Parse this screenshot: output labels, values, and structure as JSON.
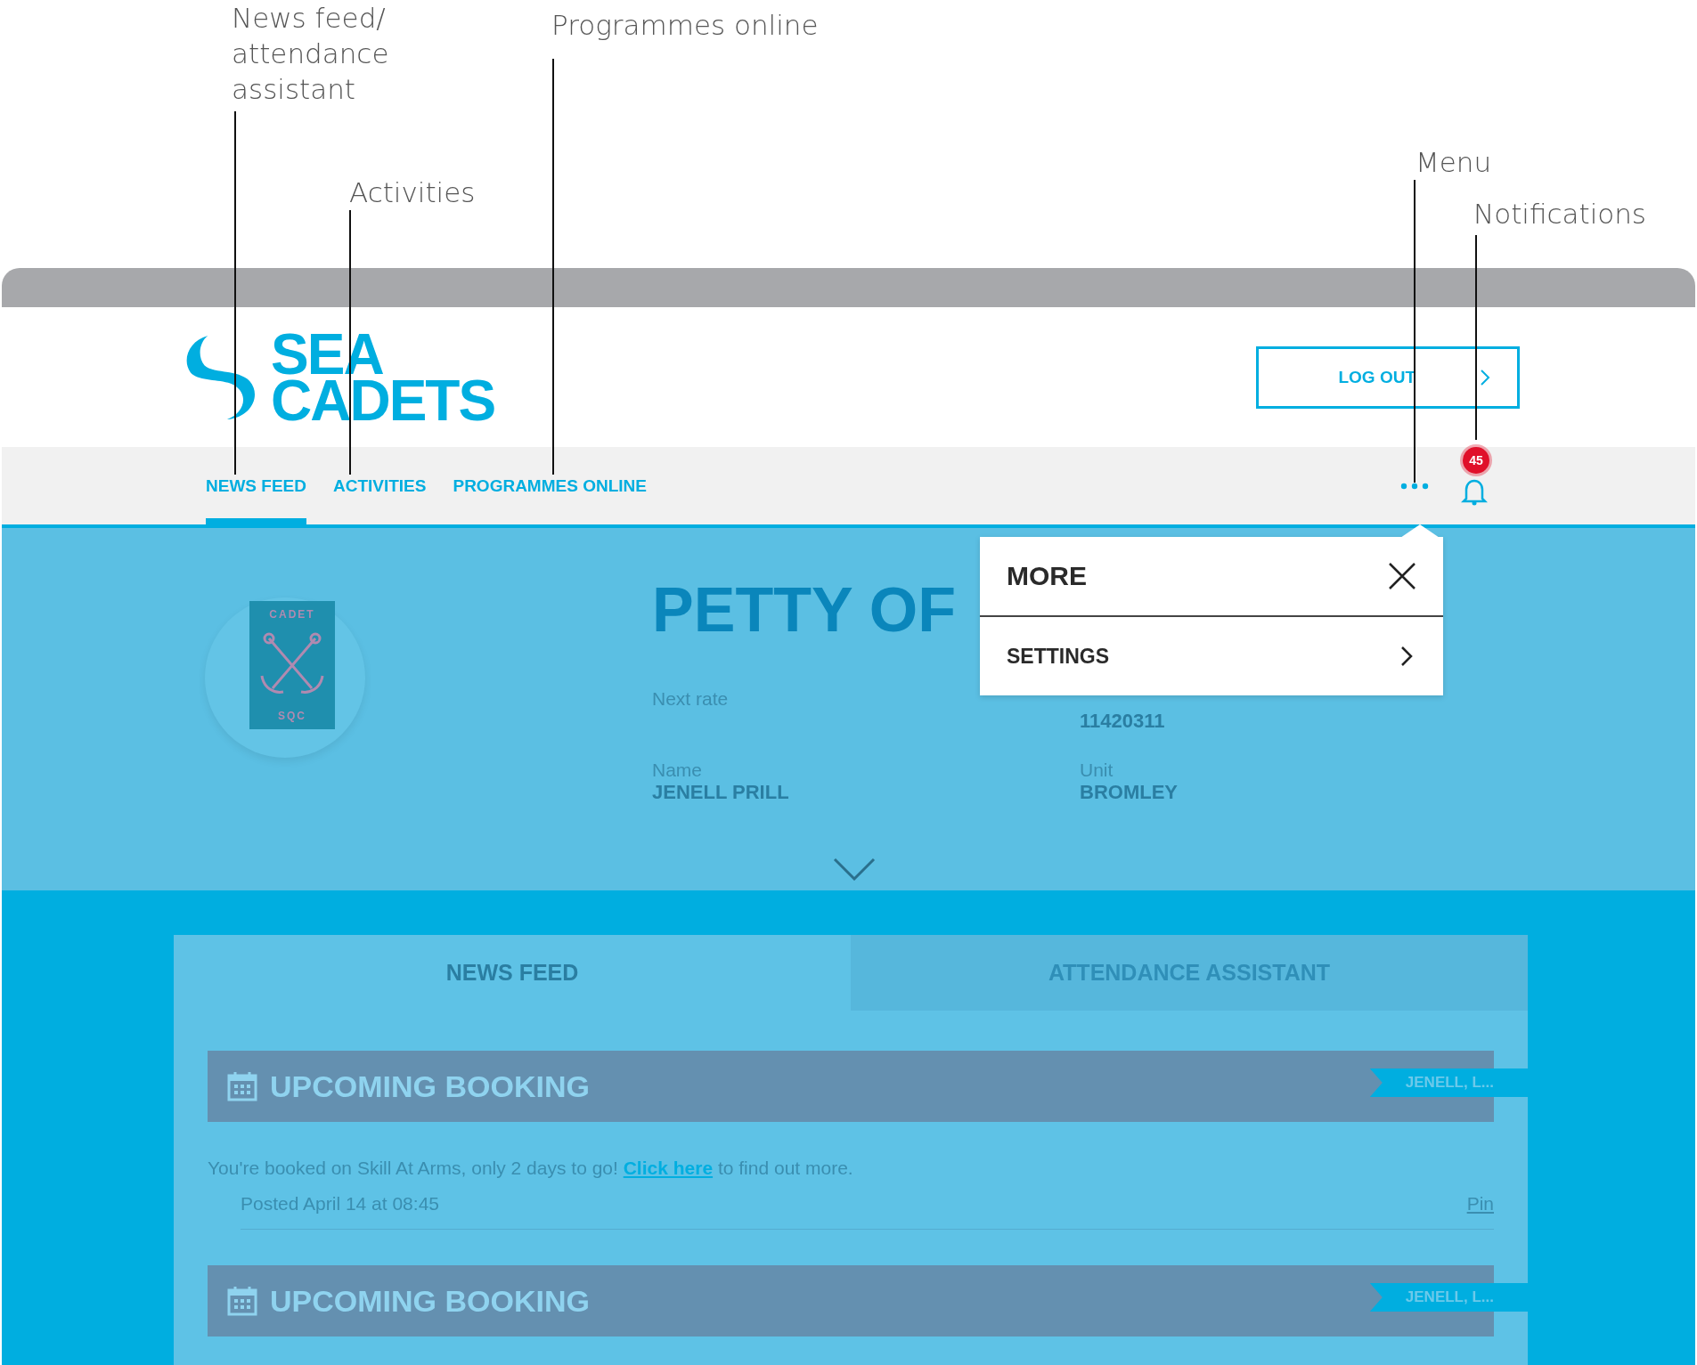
{
  "annotations": [
    {
      "text": "News feed/ attendance assistant"
    },
    {
      "text": "Activities"
    },
    {
      "text": "Programmes online"
    },
    {
      "text": "Menu"
    },
    {
      "text": "Notifications"
    }
  ],
  "header": {
    "logo": {
      "line_1": "SEA",
      "line_2": "CADETS"
    },
    "logout_button": "LOG OUT"
  },
  "nav": {
    "items": [
      {
        "label": "NEWS FEED",
        "selected": true
      },
      {
        "label": "ACTIVITIES",
        "selected": false
      },
      {
        "label": "PROGRAMMES ONLINE",
        "selected": false
      }
    ],
    "notification_count": "45"
  },
  "menu": {
    "title": "MORE",
    "items": [
      {
        "label": "SETTINGS"
      }
    ]
  },
  "profile": {
    "badge": {
      "top": "CADET",
      "bottom": "SQC"
    },
    "rank": "PETTY OF",
    "fields": [
      {
        "label": "Next rate"
      },
      {
        "value": "11420311"
      },
      {
        "label": "Name",
        "value": "JENELL PRILL"
      },
      {
        "label": "Unit",
        "value": "BROMLEY"
      }
    ]
  },
  "feed": {
    "tabs": [
      {
        "label": "NEWS FEED",
        "selected": true
      },
      {
        "label": "ATTENDANCE ASSISTANT",
        "selected": false
      }
    ],
    "posts": [
      {
        "title": "UPCOMING BOOKING",
        "tag": "JENELL, L...",
        "text": "You're booked on Skill At Arms, only 2 days to go!",
        "link": "Click here",
        "text_after": "to find out more.",
        "posted": "Posted April 14 at 08:45",
        "pin": "Pin"
      },
      {
        "title": "UPCOMING BOOKING",
        "tag": "JENELL, L..."
      }
    ]
  }
}
